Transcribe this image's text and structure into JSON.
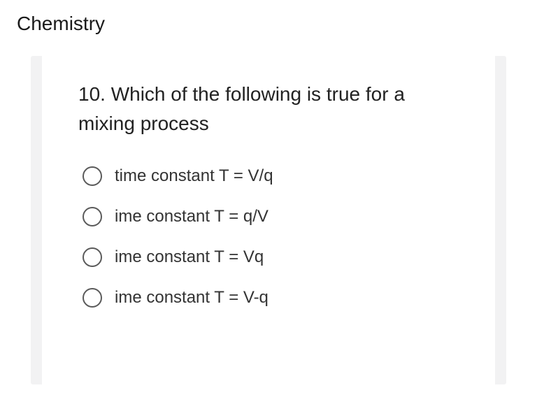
{
  "header": {
    "title": "Chemistry"
  },
  "question": {
    "text": "10. Which of the following is true for a mixing process",
    "options": [
      {
        "label": "time constant T = V/q"
      },
      {
        "label": "ime constant T = q/V"
      },
      {
        "label": "ime constant T = Vq"
      },
      {
        "label": "ime constant T = V-q"
      }
    ]
  }
}
